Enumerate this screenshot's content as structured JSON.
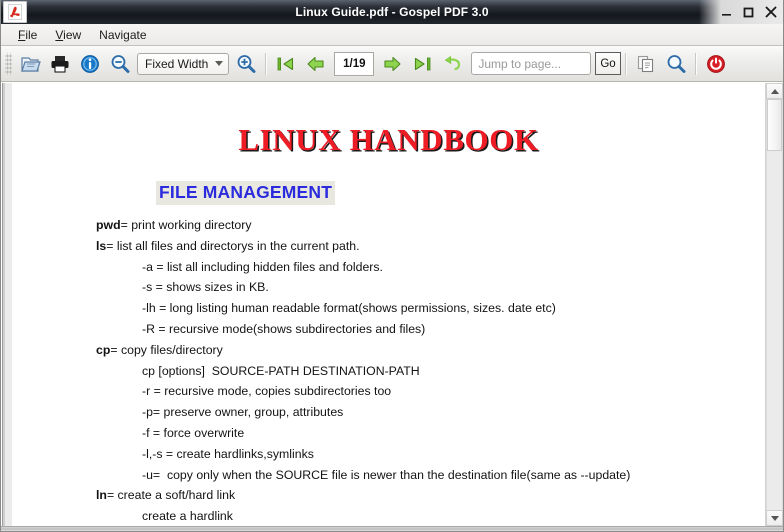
{
  "window": {
    "title": "Linux Guide.pdf - Gospel PDF 3.0",
    "app_icon": "pdf-document-icon",
    "minimize_label": "–",
    "maximize_label": "□",
    "close_label": "✕"
  },
  "menubar": {
    "items": [
      {
        "label": "File",
        "accel": "F"
      },
      {
        "label": "View",
        "accel": "V"
      },
      {
        "label": "Navigate",
        "accel": ""
      }
    ]
  },
  "toolbar": {
    "open_label": "open-file",
    "print_label": "print",
    "info_label": "document-properties",
    "zoom_out_label": "zoom-out",
    "zoom_select_value": "Fixed Width",
    "zoom_in_label": "zoom-in",
    "first_page_label": "first-page",
    "prev_page_label": "previous-page",
    "page_indicator": "1/19",
    "next_page_label": "next-page",
    "last_page_label": "last-page",
    "back_label": "go-back",
    "jump_placeholder": "Jump to page...",
    "jump_value": "",
    "go_label": "Go",
    "copy_label": "copy",
    "find_label": "find",
    "quit_label": "quit"
  },
  "document": {
    "title": "LINUX HANDBOOK",
    "section_heading": "FILE MANAGEMENT",
    "lines": [
      {
        "bold": "pwd",
        "text": "= print working directory",
        "indent": false
      },
      {
        "bold": "ls",
        "text": "= list all files and directorys in the current path.",
        "indent": false
      },
      {
        "bold": "",
        "text": "-a = list all including hidden files and folders.",
        "indent": true
      },
      {
        "bold": "",
        "text": "-s = shows sizes in KB.",
        "indent": true
      },
      {
        "bold": "",
        "text": "-lh = long listing human readable format(shows permissions, sizes. date etc)",
        "indent": true
      },
      {
        "bold": "",
        "text": "-R = recursive mode(shows subdirectories and files)",
        "indent": true
      },
      {
        "bold": "cp",
        "text": "= copy files/directory",
        "indent": false
      },
      {
        "bold": "",
        "text": "cp [options]  SOURCE-PATH DESTINATION-PATH",
        "indent": true
      },
      {
        "bold": "",
        "text": "-r = recursive mode, copies subdirectories too",
        "indent": true
      },
      {
        "bold": "",
        "text": "-p= preserve owner, group, attributes",
        "indent": true
      },
      {
        "bold": "",
        "text": "-f = force overwrite",
        "indent": true
      },
      {
        "bold": "",
        "text": "-l,-s = create hardlinks,symlinks",
        "indent": true
      },
      {
        "bold": "",
        "text": "-u=  copy only when the SOURCE file is newer than the destination file(same as --update)",
        "indent": true
      },
      {
        "bold": "ln",
        "text": "= create a soft/hard link",
        "indent": false
      },
      {
        "bold": "",
        "text": "create a hardlink",
        "indent": true
      }
    ]
  },
  "scrollbar": {
    "up_label": "scroll-up",
    "down_label": "scroll-down"
  },
  "colors": {
    "title_red": "#ee1c25",
    "heading_blue": "#2b2bdd",
    "heading_highlight": "#e8e8e0",
    "titlebar_dark": "#14171c"
  }
}
